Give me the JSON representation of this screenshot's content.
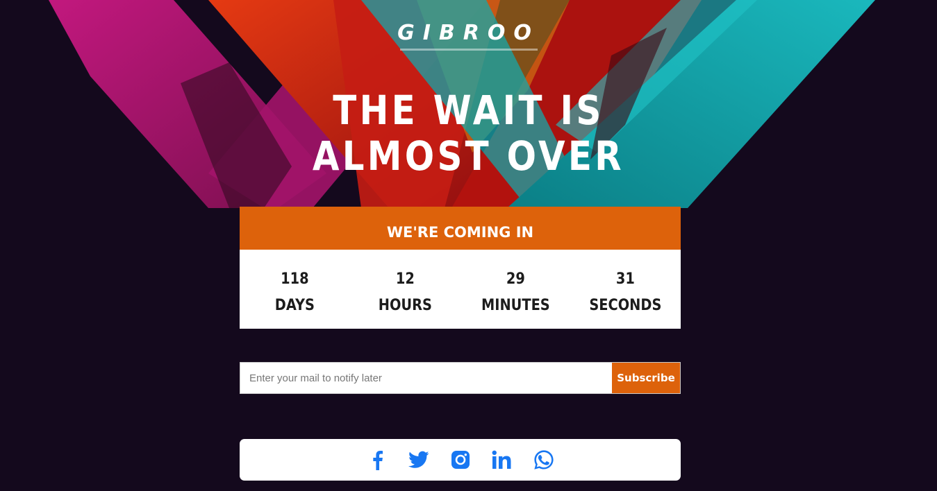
{
  "brand": {
    "name": "GIBROO"
  },
  "hero": {
    "line1": "THE WAIT IS",
    "line2": "ALMOST OVER"
  },
  "countdown": {
    "header": "WE'RE COMING IN",
    "units": [
      {
        "value": "118",
        "label": "DAYS"
      },
      {
        "value": "12",
        "label": "HOURS"
      },
      {
        "value": "29",
        "label": "MINUTES"
      },
      {
        "value": "31",
        "label": "SECONDS"
      }
    ]
  },
  "subscribe": {
    "placeholder": "Enter your mail to notify later",
    "button_label": "Subscribe"
  },
  "social": {
    "icons": [
      "facebook-icon",
      "twitter-icon",
      "instagram-icon",
      "linkedin-icon",
      "whatsapp-icon"
    ],
    "icon_color": "#1877f2"
  },
  "colors": {
    "background": "#14091d",
    "accent": "#dd620b",
    "icon": "#1877f2"
  }
}
